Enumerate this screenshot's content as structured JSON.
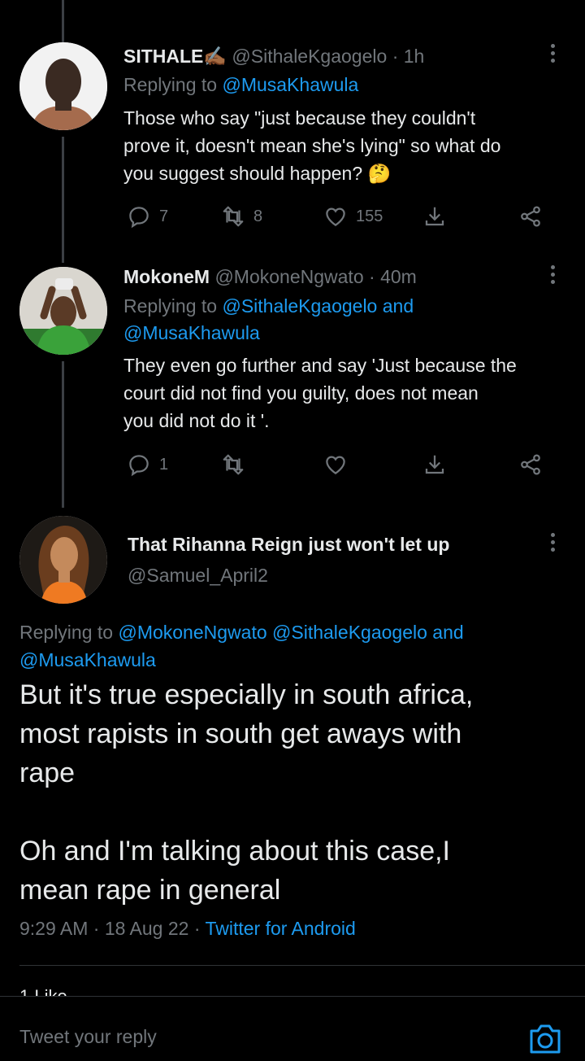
{
  "tweets": [
    {
      "display_name": "SITHALE✍🏾",
      "handle": "@SithaleKgaogelo",
      "time": "· 1h",
      "replying_prefix": "Replying to",
      "replying_to": "@MusaKhawula",
      "replying_to_line2": "",
      "text_lines": [
        "Those who say \"just because they couldn't",
        "prove it, doesn't mean she's lying\" so what do",
        "you suggest should happen? 🤔"
      ],
      "reply_count": "7",
      "retweet_count": "8",
      "like_count": "155"
    },
    {
      "display_name": "MokoneM",
      "handle": "@MokoneNgwato",
      "time": "· 40m",
      "replying_prefix": "Replying to",
      "replying_to": "@SithaleKgaogelo and",
      "replying_to_line2": "@MusaKhawula",
      "text_lines": [
        "They even go further and say 'Just because the",
        "court did not find you guilty,  does not mean",
        "you did not do it '."
      ],
      "reply_count": "1",
      "retweet_count": "",
      "like_count": ""
    }
  ],
  "main_tweet": {
    "display_name": "That Rihanna Reign just won't let up",
    "handle": "@Samuel_April2",
    "replying_prefix": "Replying to",
    "replying_line1_links": "@MokoneNgwato @SithaleKgaogelo and",
    "replying_line2": "@MusaKhawula",
    "text_lines": [
      "But it's true especially in south africa,",
      "most rapists in south get aways with",
      "rape",
      "",
      "Oh and I'm talking about this case,I",
      "mean rape in general"
    ],
    "time": "9:29 AM · 18 Aug 22 · ",
    "source": "Twitter for Android",
    "likes_partial": "1 Like"
  },
  "composer": {
    "placeholder": "Tweet your reply"
  },
  "colors": {
    "background": "#000000",
    "accent": "#1d9bf0",
    "muted": "#71767b",
    "text": "#e7e9ea"
  },
  "icons": [
    "reply-icon",
    "retweet-icon",
    "like-icon",
    "share-icon",
    "more-icon",
    "camera-icon"
  ]
}
